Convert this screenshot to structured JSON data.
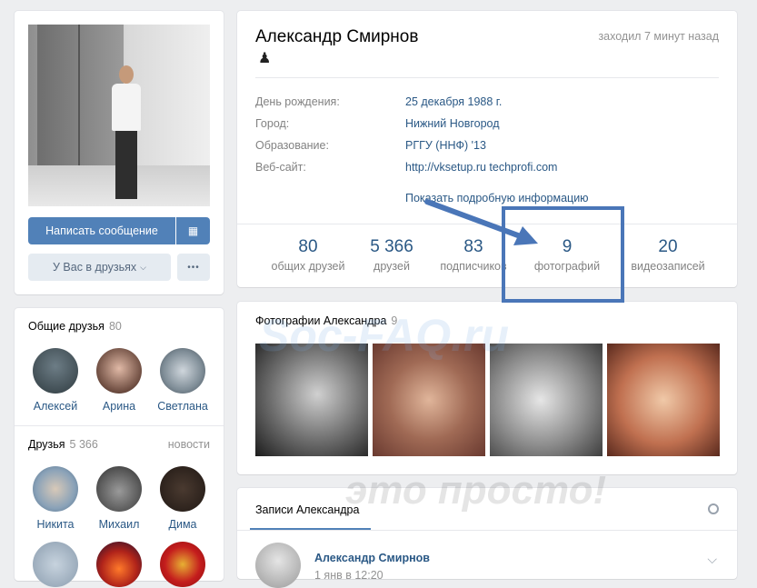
{
  "profile": {
    "name": "Александр Смирнов",
    "last_seen": "заходил 7 минут назад",
    "pawn_icon": "♟",
    "info": [
      {
        "label": "День рождения:",
        "value": "25 декабря 1988 г."
      },
      {
        "label": "Город:",
        "value": "Нижний Новгород"
      },
      {
        "label": "Образование:",
        "value": "РГГУ (ННФ) '13"
      },
      {
        "label": "Веб-сайт:",
        "value": "http://vksetup.ru techprofi.com"
      }
    ],
    "show_more": "Показать подробную информацию",
    "counters": [
      {
        "num": "80",
        "label": "общих друзей"
      },
      {
        "num": "5 366",
        "label": "друзей"
      },
      {
        "num": "83",
        "label": "подписчиков"
      },
      {
        "num": "9",
        "label": "фотографий"
      },
      {
        "num": "20",
        "label": "видеозаписей"
      }
    ]
  },
  "actions": {
    "message": "Написать сообщение",
    "gift_icon": "🎁",
    "friends": "У Вас в друзьях",
    "more_icon": "•••"
  },
  "mutual": {
    "title": "Общие друзья",
    "count": "80",
    "items": [
      "Алексей",
      "Арина",
      "Светлана"
    ]
  },
  "friends": {
    "title": "Друзья",
    "count": "5 366",
    "link": "новости",
    "items": [
      "Никита",
      "Михаил",
      "Дима"
    ]
  },
  "photos": {
    "title": "Фотографии Александра",
    "count": "9"
  },
  "wall": {
    "tab": "Записи Александра",
    "post_author": "Александр Смирнов",
    "post_time": "1 янв в 12:20"
  },
  "watermark": {
    "line1": "Soc-FAQ.ru",
    "line2": "это просто!"
  },
  "colors": {
    "accent": "#5181b8",
    "link": "#2a5885",
    "highlight": "#4a76b8"
  }
}
